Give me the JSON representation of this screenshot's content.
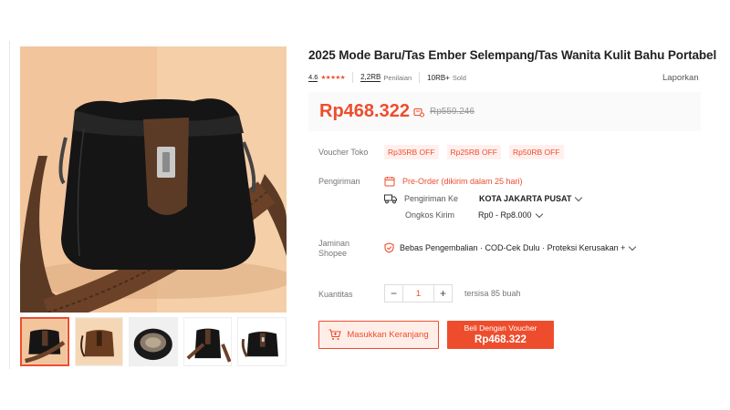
{
  "product": {
    "title": "2025 Mode Baru/Tas Ember Selempang/Tas Wanita Kulit Bahu Portabel",
    "rating": "4.6",
    "stars": "★★★★★",
    "ratings_count": "2,2RB",
    "ratings_label": "Penilaian",
    "sold_count": "10RB+",
    "sold_label": "Sold",
    "report_label": "Laporkan"
  },
  "price": {
    "current": "Rp468.322",
    "original": "Rp559.246"
  },
  "voucher": {
    "label": "Voucher Toko",
    "items": [
      "Rp35RB OFF",
      "Rp25RB OFF",
      "Rp50RB OFF"
    ]
  },
  "shipping": {
    "label": "Pengiriman",
    "preorder": "Pre-Order (dikirim dalam 25 hari)",
    "ship_to_label": "Pengiriman Ke",
    "ship_to_value": "KOTA JAKARTA PUSAT",
    "cost_label": "Ongkos Kirim",
    "cost_value": "Rp0 - Rp8.000"
  },
  "guarantee": {
    "label_line1": "Jaminan",
    "label_line2": "Shopee",
    "text": "Bebas Pengembalian · COD-Cek Dulu · Proteksi Kerusakan +"
  },
  "quantity": {
    "label": "Kuantitas",
    "value": "1",
    "minus": "−",
    "plus": "+",
    "stock": "tersisa 85 buah"
  },
  "actions": {
    "cart_label": "Masukkan Keranjang",
    "buy_label": "Beli Dengan Voucher",
    "buy_price": "Rp468.322"
  },
  "colors": {
    "brand": "#ee4d2d",
    "voucher_bg": "#fff0ee",
    "image_bg": "#f2c59d"
  },
  "icons": [
    "price-tag-icon",
    "calendar-icon",
    "truck-icon",
    "shield-icon",
    "chevron-down-icon",
    "cart-icon"
  ]
}
